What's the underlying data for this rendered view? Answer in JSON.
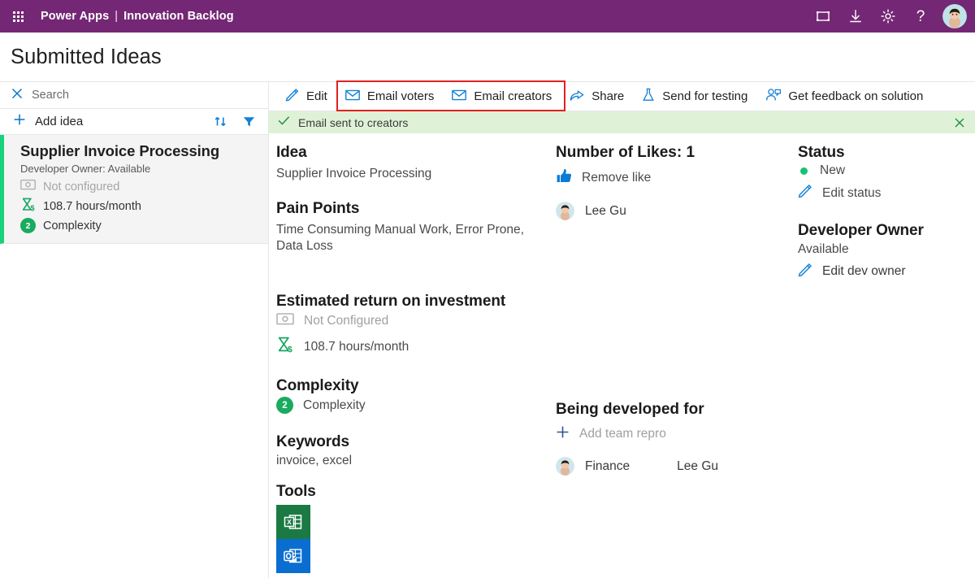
{
  "suitebar": {
    "waffle_icon": "app-launcher-icon",
    "app_name": "Power Apps",
    "separator": "|",
    "environment": "Innovation Backlog",
    "actions": [
      {
        "name": "fullscreen-icon",
        "label": "Fullscreen"
      },
      {
        "name": "download-icon",
        "label": "Download"
      },
      {
        "name": "gear-icon",
        "label": "Settings"
      },
      {
        "name": "help-icon",
        "label": "?"
      }
    ],
    "avatar": "user-avatar"
  },
  "page": {
    "title": "Submitted Ideas"
  },
  "sidebar": {
    "search": {
      "icon": "close-icon",
      "placeholder": "Search",
      "value": ""
    },
    "add": {
      "icon": "plus-icon",
      "label": "Add idea"
    },
    "sort_icon": "sort-icon",
    "filter_icon": "filter-icon",
    "idea": {
      "title": "Supplier Invoice Processing",
      "owner_line": "Developer Owner: Available",
      "roi_money": "Not configured",
      "roi_hours": "108.7 hours/month",
      "complexity_badge": "2",
      "complexity_label": "Complexity",
      "accent_color": "#19d07b"
    }
  },
  "commandbar": {
    "commands": [
      {
        "name": "edit-command",
        "icon": "pencil-icon",
        "label": "Edit"
      },
      {
        "name": "email-voters-command",
        "icon": "mail-icon",
        "label": "Email voters"
      },
      {
        "name": "email-creators-command",
        "icon": "mail-icon",
        "label": "Email creators"
      },
      {
        "name": "share-command",
        "icon": "share-icon",
        "label": "Share"
      },
      {
        "name": "send-for-testing-command",
        "icon": "flask-icon",
        "label": "Send for testing"
      },
      {
        "name": "get-feedback-command",
        "icon": "feedback-person-icon",
        "label": "Get feedback on solution"
      }
    ],
    "highlight_color": "#e02020"
  },
  "banner": {
    "icon": "checkmark-icon",
    "message": "Email sent to creators",
    "close_icon": "close-icon",
    "background": "#dff2d8",
    "accent": "#107c10"
  },
  "details": {
    "idea_heading": "Idea",
    "idea_value": "Supplier Invoice Processing",
    "pain_heading": "Pain Points",
    "pain_value": "Time Consuming Manual Work, Error Prone, Data Loss",
    "roi_heading": "Estimated return on investment",
    "roi_money": "Not Configured",
    "roi_hours": "108.7 hours/month",
    "complexity_heading": "Complexity",
    "complexity_badge": "2",
    "complexity_value": "Complexity",
    "keywords_heading": "Keywords",
    "keywords_value": "invoice, excel",
    "tools_heading": "Tools",
    "tools": [
      {
        "name": "excel-tool-icon",
        "label": "Excel",
        "color": "#1b7a43"
      },
      {
        "name": "outlook-tool-icon",
        "label": "Outlook",
        "color": "#0a6ed1"
      }
    ]
  },
  "likes": {
    "heading": "Number of Likes: 1",
    "action_icon": "thumbs-up-icon",
    "action_label": "Remove like",
    "voters": [
      {
        "name": "Lee Gu",
        "avatar": "user-avatar"
      }
    ]
  },
  "developed_for": {
    "heading": "Being developed for",
    "add_icon": "plus-icon",
    "add_label": "Add team repro",
    "team": {
      "avatar": "user-avatar",
      "team_name": "Finance",
      "person_name": "Lee Gu"
    }
  },
  "status": {
    "heading": "Status",
    "dot_color": "#16c172",
    "value": "New",
    "edit_icon": "pencil-icon",
    "edit_label": "Edit status"
  },
  "developer_owner": {
    "heading": "Developer Owner",
    "value": "Available",
    "edit_icon": "pencil-icon",
    "edit_label": "Edit dev owner"
  }
}
